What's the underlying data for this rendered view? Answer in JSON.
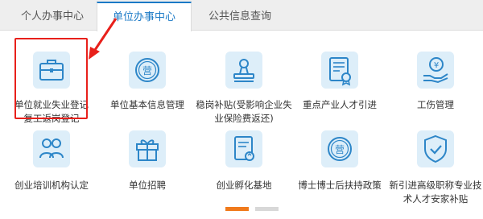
{
  "tabs": [
    {
      "label": "个人办事中心",
      "active": false
    },
    {
      "label": "单位办事中心",
      "active": true
    },
    {
      "label": "公共信息查询",
      "active": false
    }
  ],
  "services": [
    {
      "label": "单位就业失业登记\n复工返岗登记",
      "icon": "briefcase-icon"
    },
    {
      "label": "单位基本信息管理",
      "icon": "stamp-ying-icon"
    },
    {
      "label": "稳岗补贴(受影响企业失\n业保险费返还)",
      "icon": "seal-icon"
    },
    {
      "label": "重点产业人才引进",
      "icon": "certificate-icon"
    },
    {
      "label": "工伤管理",
      "icon": "hand-yen-icon"
    },
    {
      "label": "创业培训机构认定",
      "icon": "people-icon"
    },
    {
      "label": "单位招聘",
      "icon": "gift-icon"
    },
    {
      "label": "创业孵化基地",
      "icon": "document-refresh-icon"
    },
    {
      "label": "博士博士后扶持政策",
      "icon": "stamp-ying-icon"
    },
    {
      "label": "新引进高级职称专业技\n术人才安家补贴",
      "icon": "shield-check-icon"
    }
  ],
  "pager": {
    "pages": 2,
    "current": 1
  },
  "colors": {
    "accent": "#1a79c6",
    "highlight": "#e8201b",
    "pager_active": "#f07a1c",
    "icon_bg": "#ddeef9",
    "icon_stroke": "#2d86c8"
  }
}
